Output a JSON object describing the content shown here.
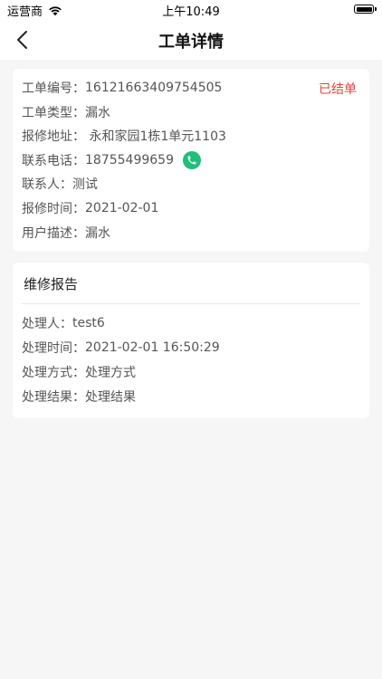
{
  "status_bar": {
    "carrier": "运营商",
    "time": "上午10:49"
  },
  "nav": {
    "title": "工单详情"
  },
  "order": {
    "status": "已结单",
    "status_color": "#e6413c",
    "fields": [
      {
        "label": "工单编号：",
        "value": "16121663409754505"
      },
      {
        "label": "工单类型：",
        "value": "漏水"
      },
      {
        "label": "报修地址：",
        "value": " 永和家园1栋1单元1103"
      },
      {
        "label": "联系电话：",
        "value": "18755499659"
      },
      {
        "label": "联系人：",
        "value": "测试"
      },
      {
        "label": "报修时间：",
        "value": "2021-02-01"
      },
      {
        "label": "用户描述：",
        "value": "漏水"
      }
    ]
  },
  "report": {
    "title": "维修报告",
    "fields": [
      {
        "label": "处理人：",
        "value": "test6"
      },
      {
        "label": "处理时间：",
        "value": "2021-02-01 16:50:29"
      },
      {
        "label": "处理方式：",
        "value": "处理方式"
      },
      {
        "label": "处理结果：",
        "value": "处理结果"
      }
    ]
  },
  "colors": {
    "accent_green": "#1fbf7a",
    "background": "#f6f6f6"
  },
  "icons": {
    "back": "chevron-left-icon",
    "phone": "phone-icon",
    "wifi": "wifi-icon",
    "battery": "battery-icon"
  }
}
